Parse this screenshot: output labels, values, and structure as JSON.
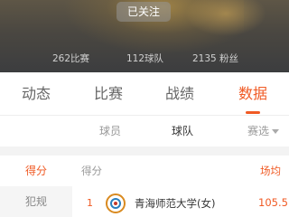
{
  "header": {
    "follow_label": "已关注",
    "stats": {
      "matches": "262比赛",
      "teams": "112球队",
      "fans": "2135 粉丝"
    }
  },
  "tabs": [
    {
      "label": "动态"
    },
    {
      "label": "比赛"
    },
    {
      "label": "战绩"
    },
    {
      "label": "数据",
      "active": true
    }
  ],
  "subtabs": {
    "players": "球员",
    "teams": "球队",
    "filter": "赛选"
  },
  "left_nav": [
    {
      "label": "得分",
      "active": true
    },
    {
      "label": "犯规"
    }
  ],
  "table": {
    "col_left": "得分",
    "col_right": "场均",
    "rows": [
      {
        "rank": "1",
        "team": "青海师范大学(女)",
        "value": "105.5"
      }
    ]
  },
  "colors": {
    "accent": "#f05a24",
    "hero_dark": "#3c3d3f"
  }
}
